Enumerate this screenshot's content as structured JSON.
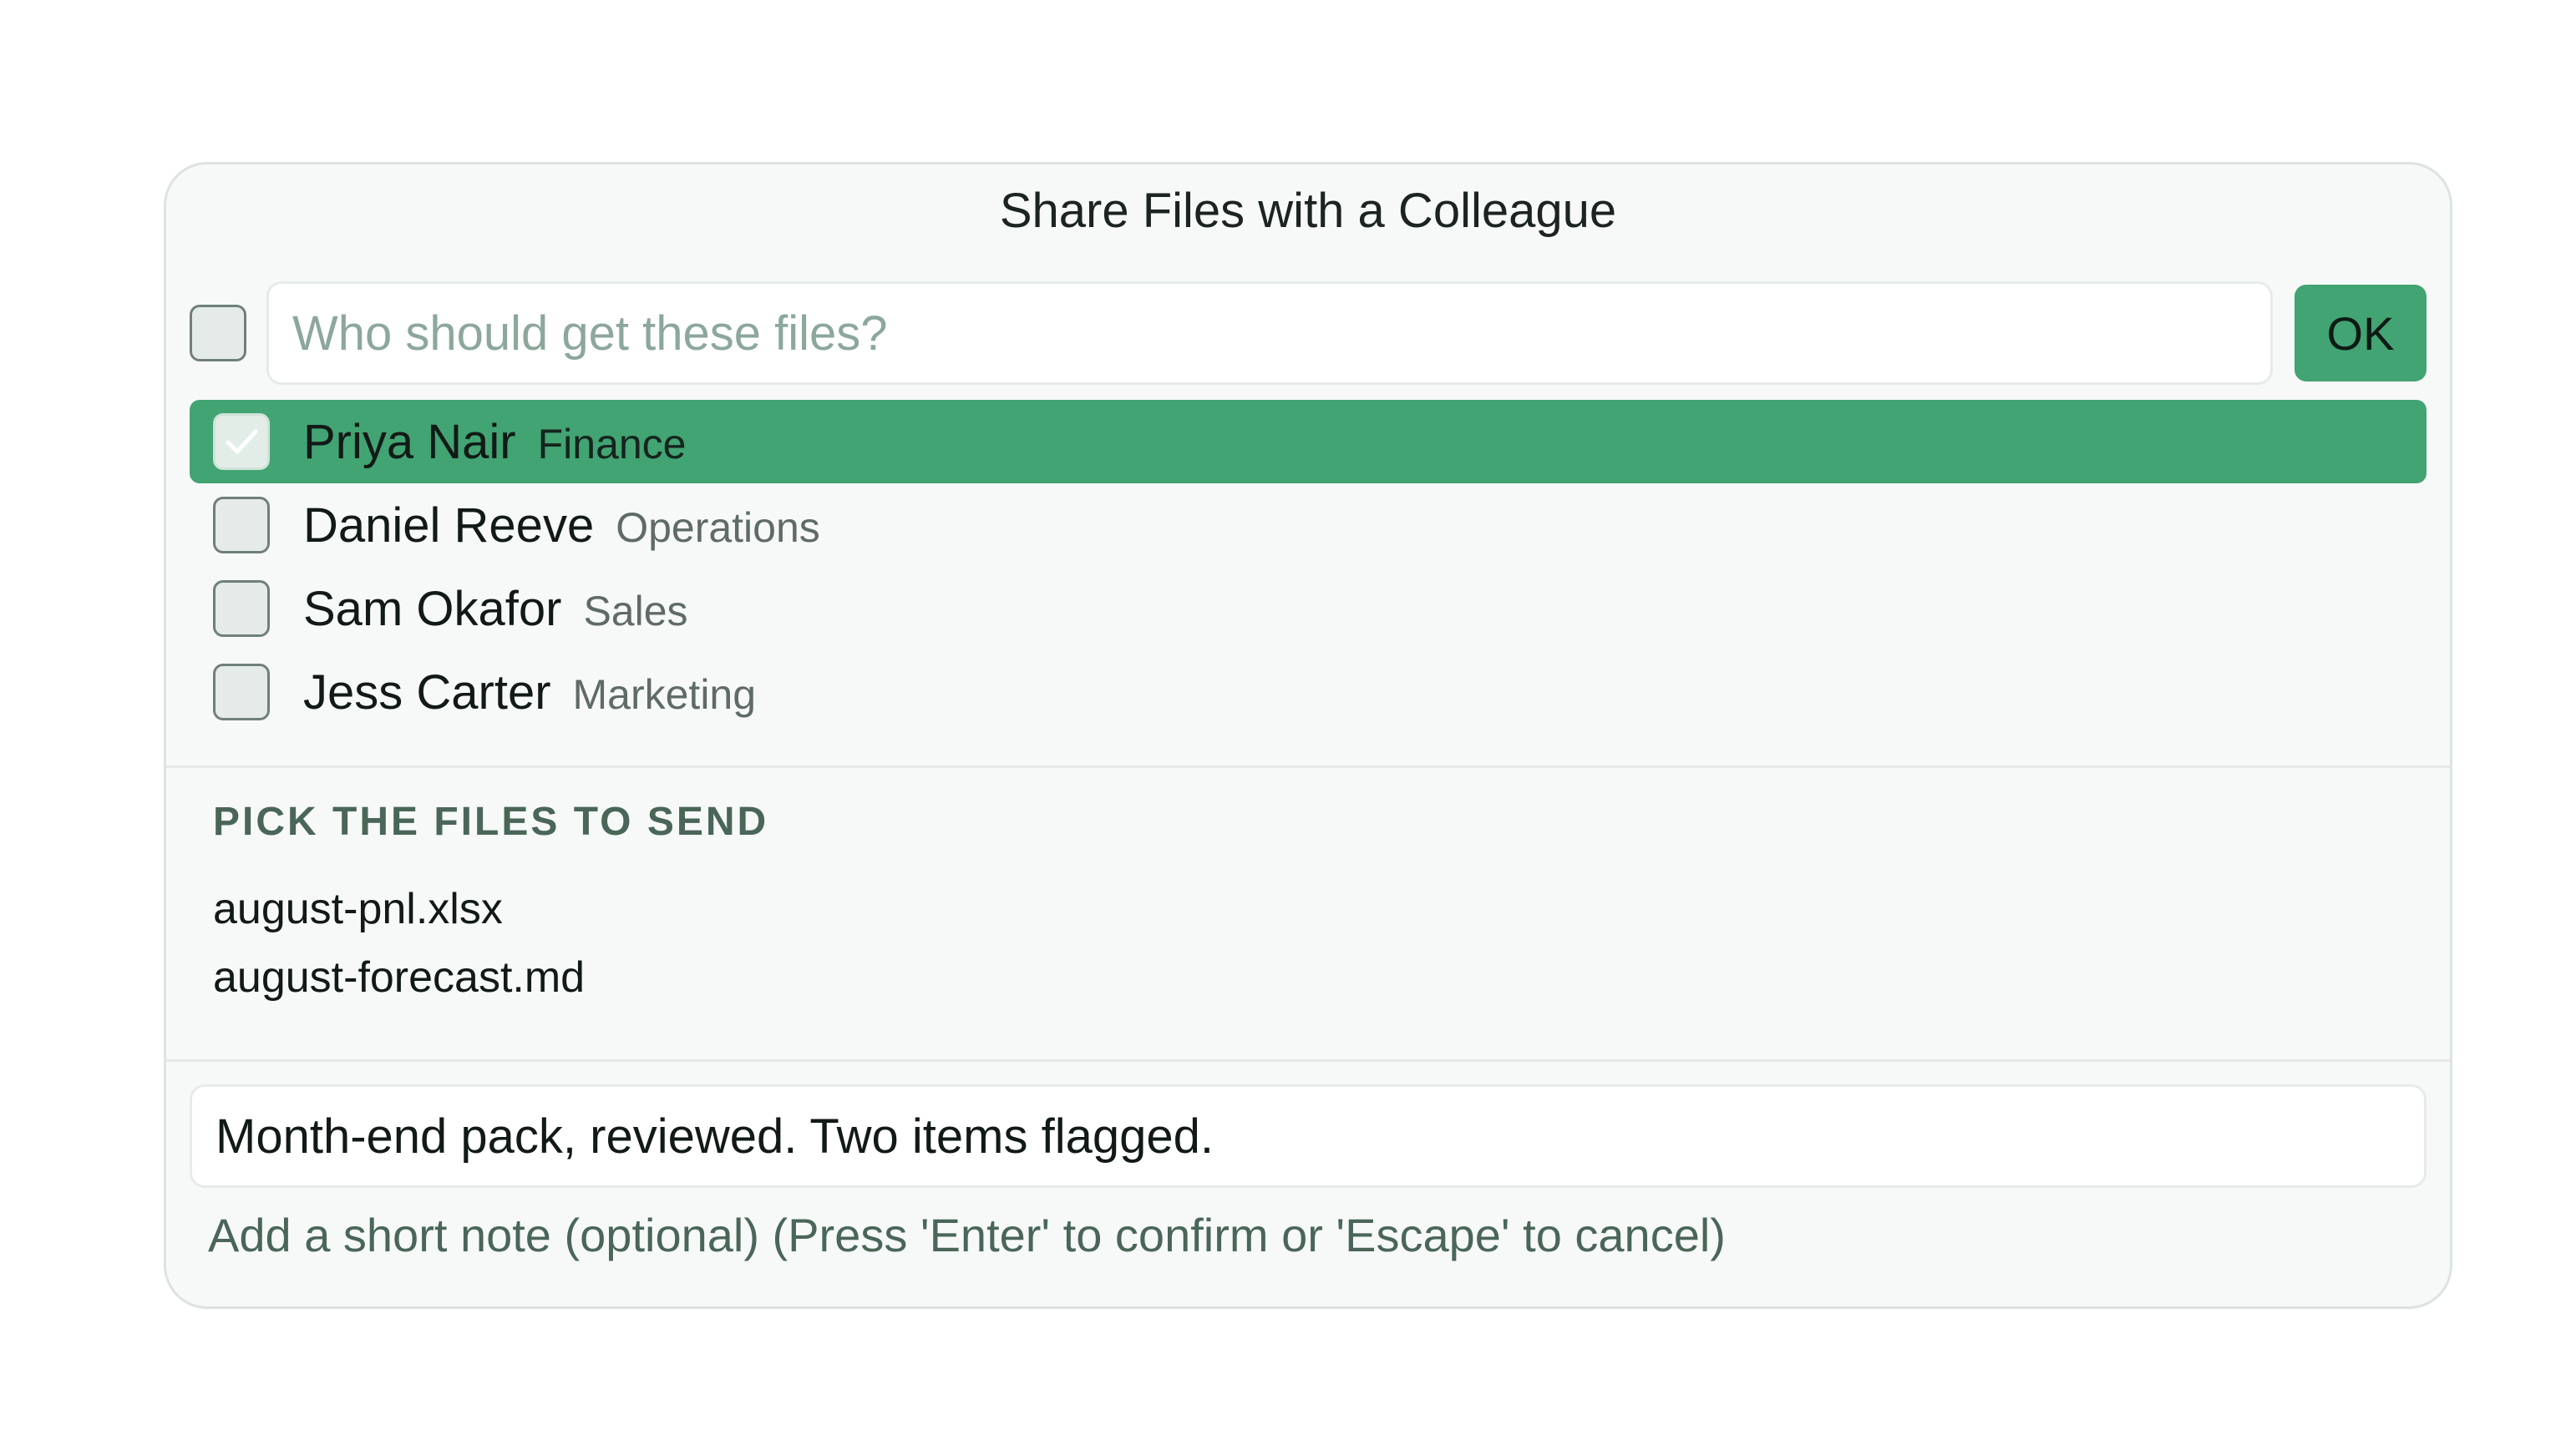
{
  "dialog": {
    "title": "Share Files with a Colleague"
  },
  "search": {
    "placeholder": "Who should get these files?",
    "value": "",
    "ok_label": "OK"
  },
  "recipients": [
    {
      "name": "Priya Nair",
      "department": "Finance",
      "selected": true,
      "checked": true
    },
    {
      "name": "Daniel Reeve",
      "department": "Operations",
      "selected": false,
      "checked": false
    },
    {
      "name": "Sam Okafor",
      "department": "Sales",
      "selected": false,
      "checked": false
    },
    {
      "name": "Jess Carter",
      "department": "Marketing",
      "selected": false,
      "checked": false
    }
  ],
  "files": {
    "heading": "PICK THE FILES TO SEND",
    "items": [
      "august-pnl.xlsx",
      "august-forecast.md"
    ]
  },
  "note": {
    "value": "Month-end pack, reviewed. Two items flagged.",
    "hint": "Add a short note (optional) (Press 'Enter' to confirm or 'Escape' to cancel)"
  },
  "colors": {
    "accent": "#42a373",
    "heading": "#4a6659",
    "placeholder": "#8ca79b"
  }
}
